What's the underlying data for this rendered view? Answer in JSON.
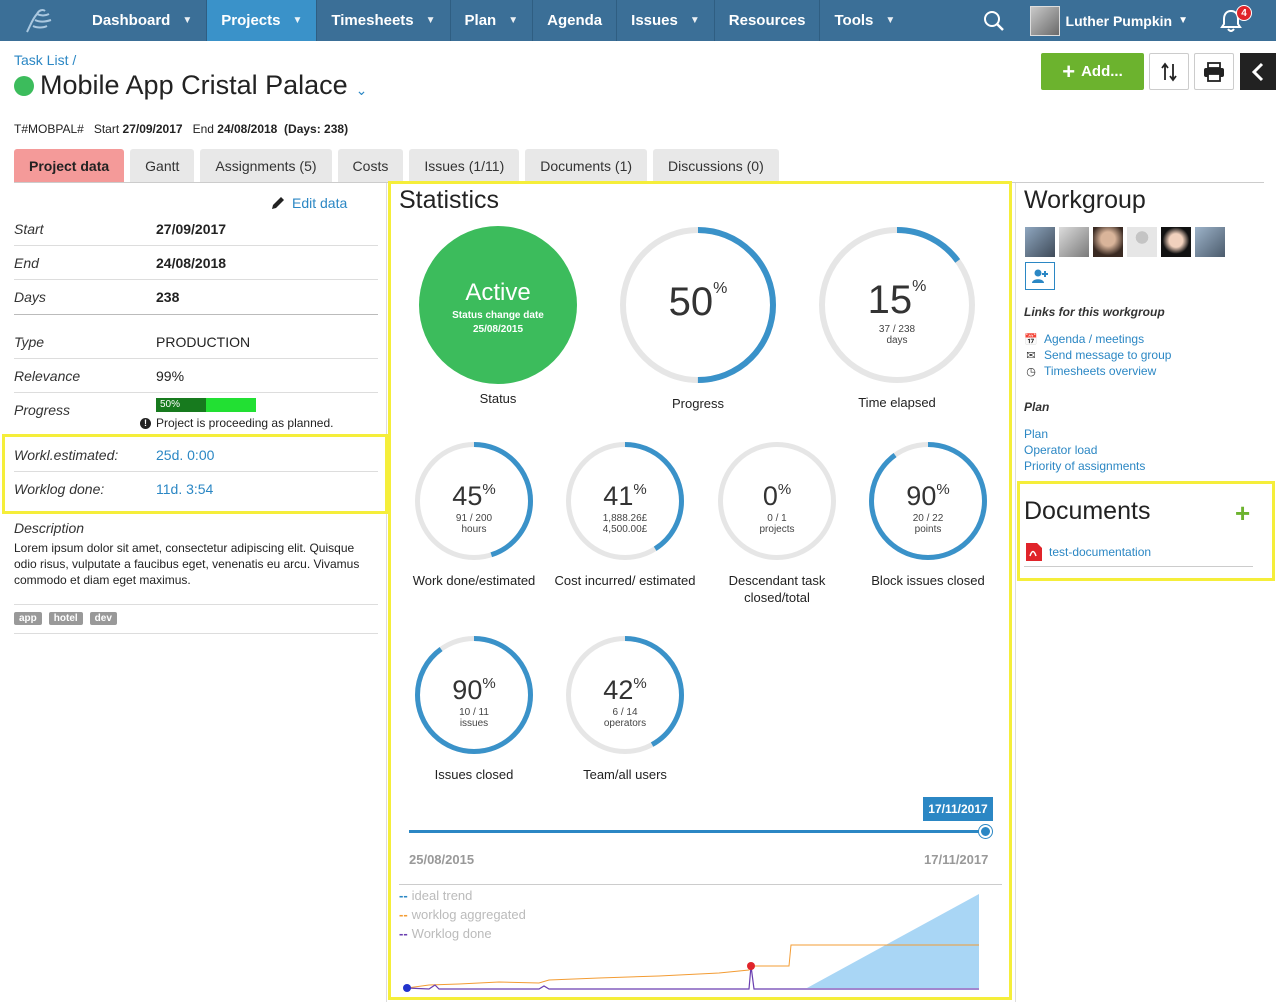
{
  "nav": {
    "items": [
      {
        "label": "Dashboard",
        "has_menu": true
      },
      {
        "label": "Projects",
        "has_menu": true,
        "active": true
      },
      {
        "label": "Timesheets",
        "has_menu": true
      },
      {
        "label": "Plan",
        "has_menu": true
      },
      {
        "label": "Agenda",
        "has_menu": false
      },
      {
        "label": "Issues",
        "has_menu": true
      },
      {
        "label": "Resources",
        "has_menu": false
      },
      {
        "label": "Tools",
        "has_menu": true
      }
    ],
    "user_name": "Luther Pumpkin",
    "notification_count": "4",
    "colors": {
      "bar": "#3b6f97",
      "active": "#3a92c9"
    }
  },
  "header": {
    "breadcrumb": "Task List /",
    "title": "Mobile App Cristal Palace",
    "code": "T#MOBPAL#",
    "start_label": "Start",
    "start": "27/09/2017",
    "end_label": "End",
    "end": "24/08/2018",
    "days": "(Days: 238)",
    "add_label": "Add..."
  },
  "tabs": [
    {
      "label": "Project data",
      "active": true
    },
    {
      "label": "Gantt"
    },
    {
      "label": "Assignments (5)"
    },
    {
      "label": "Costs"
    },
    {
      "label": "Issues (1/11)"
    },
    {
      "label": "Documents (1)"
    },
    {
      "label": "Discussions (0)"
    }
  ],
  "project": {
    "edit_label": "Edit data",
    "fields": {
      "start": {
        "label": "Start",
        "value": "27/09/2017"
      },
      "end": {
        "label": "End",
        "value": "24/08/2018"
      },
      "days": {
        "label": "Days",
        "value": "238"
      },
      "type": {
        "label": "Type",
        "value": "PRODUCTION"
      },
      "relevance": {
        "label": "Relevance",
        "value": "99%"
      },
      "progress": {
        "label": "Progress",
        "value": "50%",
        "fraction": 0.5
      },
      "work_est": {
        "label": "Workl.estimated:",
        "value": "25d. 0:00"
      },
      "work_done": {
        "label": "Worklog done:",
        "value": "11d. 3:54"
      }
    },
    "progress_note": "Project is proceeding as planned.",
    "description_label": "Description",
    "description": "Lorem ipsum dolor sit amet, consectetur adipiscing elit. Quisque odio risus, vulputate a faucibus eget, venenatis eu arcu. Vivamus commodo et diam eget maximus.",
    "tags": [
      "app",
      "hotel",
      "dev"
    ]
  },
  "stats": {
    "title": "Statistics",
    "status": {
      "value": "Active",
      "sub": "Status change date",
      "date": "25/08/2015",
      "label": "Status"
    },
    "progress": {
      "value": "50",
      "pct": "%",
      "fraction": 0.5,
      "label": "Progress"
    },
    "time": {
      "value": "15",
      "pct": "%",
      "fraction": 0.15,
      "sub1": "37 / 238",
      "sub2": "days",
      "label": "Time elapsed"
    },
    "work": {
      "value": "45",
      "pct": "%",
      "fraction": 0.45,
      "sub1": "91 / 200",
      "sub2": "hours",
      "label": "Work done/estimated"
    },
    "cost": {
      "value": "41",
      "pct": "%",
      "fraction": 0.41,
      "sub1": "1,888.26£",
      "sub2": "4,500.00£",
      "label": "Cost incurred/ estimated"
    },
    "desc": {
      "value": "0",
      "pct": "%",
      "fraction": 0,
      "sub1": "0 / 1",
      "sub2": "projects",
      "label1": "Descendant task",
      "label2": "closed/total"
    },
    "block": {
      "value": "90",
      "pct": "%",
      "fraction": 0.9,
      "sub1": "20 / 22",
      "sub2": "points",
      "label": "Block issues closed"
    },
    "issues": {
      "value": "90",
      "pct": "%",
      "fraction": 0.9,
      "sub1": "10 / 11",
      "sub2": "issues",
      "label": "Issues closed"
    },
    "team": {
      "value": "42",
      "pct": "%",
      "fraction": 0.42,
      "sub1": "6 / 14",
      "sub2": "operators",
      "label": "Team/all users"
    },
    "slider": {
      "current": "17/11/2017",
      "from": "25/08/2015",
      "to": "17/11/2017"
    },
    "legend": [
      {
        "label": "ideal trend",
        "color": "#2b87c4"
      },
      {
        "label": "worklog aggregated",
        "color": "#f39c34"
      },
      {
        "label": "Worklog done",
        "color": "#6a3fb0"
      }
    ]
  },
  "workgroup": {
    "title": "Workgroup",
    "links_title": "Links for this workgroup",
    "links": [
      "Agenda / meetings",
      "Send message to group",
      "Timesheets overview"
    ],
    "plan_title": "Plan",
    "plan_links": [
      "Plan",
      "Operator load",
      "Priority of assignments"
    ]
  },
  "documents": {
    "title": "Documents",
    "items": [
      "test-documentation"
    ]
  }
}
